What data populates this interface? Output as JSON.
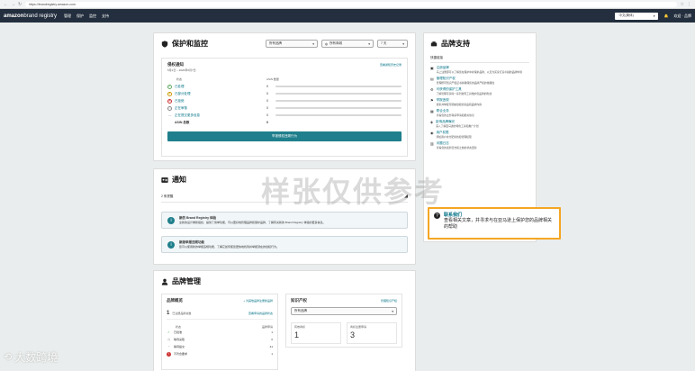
{
  "browser": {
    "url": "https://brandregistry.amazon.com"
  },
  "topnav": {
    "logo_main": "amazon",
    "logo_sub": "brand registry",
    "menu": [
      "管理",
      "保护",
      "监控",
      "支持"
    ],
    "lang": "中文(简体)",
    "user": "欢迎 · 品牌"
  },
  "protect": {
    "title": "保护和监控",
    "filter_brand": "所有品牌",
    "filter_site": "所有商城",
    "filter_days": "7 天",
    "section_title": "侵权通知",
    "date_range": "5月1日 – 2020年5月7日",
    "view_all": "查看通知历史记录",
    "col_status": "状态",
    "col_asin": "ASIN 数量",
    "rows": [
      {
        "label": "已处理",
        "value": "0"
      },
      {
        "label": "已部分处理",
        "value": "0"
      },
      {
        "label": "已拒绝",
        "value": "0"
      },
      {
        "label": "正在审核",
        "value": "0"
      },
      {
        "label": "正在提交更多信息",
        "value": "0"
      }
    ],
    "total_label": "ASIN 总数",
    "total_value": "0",
    "action_button": "举报侵权违规行为"
  },
  "notices": {
    "title": "通知",
    "count": "2 条提醒",
    "items": [
      {
        "title": "新的 Brand Registry 体验",
        "text": "全新的设计重新组织，提供了简单功能，可以更好地管理品牌和保护品牌，了解有关新的 Brand Registry 体验的更多信息。"
      },
      {
        "title": "新版举报违规功能",
        "text": "您可以使用新的举报违规功能，了解它如何使您更快地找到并举报潜在的侵权行为。"
      }
    ]
  },
  "brand_mgmt": {
    "title": "品牌管理",
    "overview_title": "品牌概览",
    "add_brand": "+ 为其他品牌注册新品牌",
    "registered_count": "1",
    "registered_label": "已注册品牌总数",
    "view_apps": "查看申请的品牌状态",
    "col_status": "状态",
    "col_count": "品牌申请",
    "statuses": [
      {
        "label": "已批准",
        "value": "1"
      },
      {
        "label": "等待采取",
        "value": "0"
      },
      {
        "label": "等待提交",
        "value": "41"
      },
      {
        "label": "不符合要求",
        "value": "1"
      }
    ],
    "ip_title": "知识产权",
    "ip_link": "管理知识产权",
    "ip_select": "所有品牌",
    "ip_stat1_label": "有效商标",
    "ip_stat1_value": "1",
    "ip_stat2_label": "商标注册申请",
    "ip_stat2_value": "3"
  },
  "support": {
    "title": "品牌支持",
    "quick_links": "快捷链接",
    "links": [
      {
        "title": "注册品牌",
        "text": "马上注册即可以了解您在保护中并保护品牌，以及为买家打造卓越的品牌体验"
      },
      {
        "title": "管理知识产权",
        "text": "管理所有知识产权证书并确保您的品牌产权的准确性"
      },
      {
        "title": "可获得的保护工具",
        "text": "了解管理可获得一系列独有工具维护您品牌的利益"
      },
      {
        "title": "举报违规",
        "text": "搜索并举报可能被侵权的商品和品牌内容"
      },
      {
        "title": "联合业务",
        "text": "查看您的业务联系申请和相关协议"
      },
      {
        "title": "影响品牌曝光",
        "text": "深入了解亚马逊的特色工具和推广计划"
      },
      {
        "title": "用户权限",
        "text": "添加用户并分配角色和管理权限"
      },
      {
        "title": "问题日志",
        "text": "查看您的案例日志和之前的状态更新"
      }
    ],
    "contact_title": "联系我们",
    "contact_text": "查看相关文章，并寻求与在亚马逊上保护您的品牌相关的帮助"
  },
  "overlay": {
    "watermark": "样张仅供参考",
    "brand": "大数跨境"
  }
}
